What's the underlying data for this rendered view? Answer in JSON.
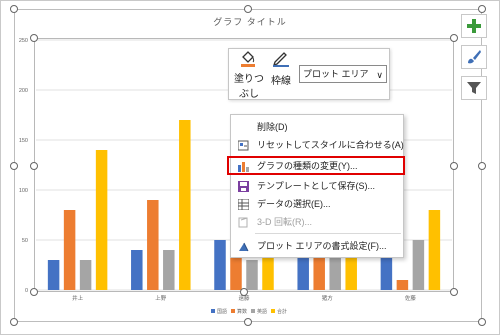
{
  "chart_data": {
    "type": "bar",
    "title": "グラフ タイトル",
    "categories": [
      "井上",
      "上野",
      "遠藤",
      "猪方",
      "佐藤"
    ],
    "series": [
      {
        "name": "国語",
        "color": "#4472C4",
        "values": [
          30,
          40,
          50,
          60,
          70
        ]
      },
      {
        "name": "算数",
        "color": "#ED7D31",
        "values": [
          80,
          90,
          80,
          40,
          10
        ]
      },
      {
        "name": "英語",
        "color": "#A5A5A5",
        "values": [
          30,
          40,
          30,
          50,
          50
        ]
      },
      {
        "name": "合計",
        "color": "#FFC000",
        "values": [
          140,
          170,
          160,
          150,
          80
        ]
      }
    ],
    "yticks": [
      "0",
      "50",
      "100",
      "150",
      "200",
      "250"
    ],
    "ylim": [
      0,
      250
    ],
    "grid": true,
    "legend_position": "bottom"
  },
  "format_toolbar": {
    "fill_label_line1": "塗りつ",
    "fill_label_line2": "ぶし",
    "outline_label": "枠線",
    "element_select": "プロット エリア",
    "fill_icon": "paint-bucket-icon",
    "outline_icon": "pen-icon"
  },
  "side_buttons": {
    "elements_icon": "plus-icon",
    "styles_icon": "brush-icon",
    "filter_icon": "funnel-icon"
  },
  "context_menu": {
    "items": [
      {
        "label": "削除(D)",
        "icon": "",
        "disabled": false
      },
      {
        "label": "リセットしてスタイルに合わせる(A)",
        "icon": "reset-style-icon",
        "disabled": false
      },
      {
        "label": "グラフの種類の変更(Y)...",
        "icon": "bar-chart-icon",
        "disabled": false,
        "highlighted": true
      },
      {
        "label": "テンプレートとして保存(S)...",
        "icon": "save-template-icon",
        "disabled": false
      },
      {
        "label": "データの選択(E)...",
        "icon": "data-table-icon",
        "disabled": false
      },
      {
        "label": "3-D 回転(R)...",
        "icon": "rotate-3d-icon",
        "disabled": true
      },
      {
        "label": "プロット エリアの書式設定(F)...",
        "icon": "format-icon",
        "disabled": false
      }
    ]
  },
  "colors": {
    "highlight_border": "#E00000",
    "side_plus": "#3A9A3A"
  }
}
